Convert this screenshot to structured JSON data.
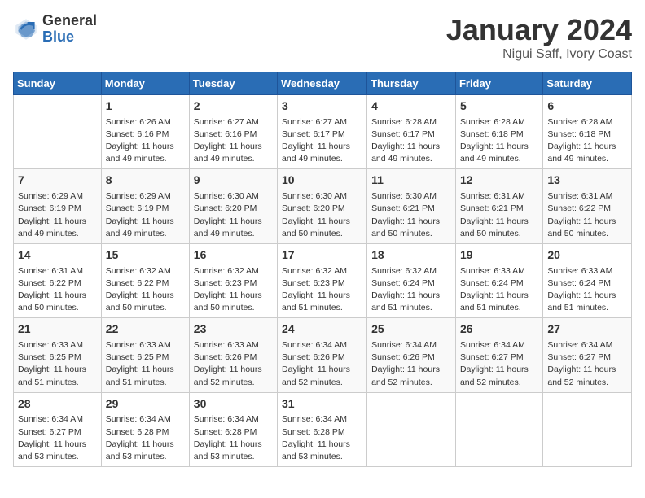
{
  "logo": {
    "general": "General",
    "blue": "Blue"
  },
  "title": "January 2024",
  "location": "Nigui Saff, Ivory Coast",
  "days_of_week": [
    "Sunday",
    "Monday",
    "Tuesday",
    "Wednesday",
    "Thursday",
    "Friday",
    "Saturday"
  ],
  "weeks": [
    [
      {
        "day": "",
        "info": ""
      },
      {
        "day": "1",
        "info": "Sunrise: 6:26 AM\nSunset: 6:16 PM\nDaylight: 11 hours\nand 49 minutes."
      },
      {
        "day": "2",
        "info": "Sunrise: 6:27 AM\nSunset: 6:16 PM\nDaylight: 11 hours\nand 49 minutes."
      },
      {
        "day": "3",
        "info": "Sunrise: 6:27 AM\nSunset: 6:17 PM\nDaylight: 11 hours\nand 49 minutes."
      },
      {
        "day": "4",
        "info": "Sunrise: 6:28 AM\nSunset: 6:17 PM\nDaylight: 11 hours\nand 49 minutes."
      },
      {
        "day": "5",
        "info": "Sunrise: 6:28 AM\nSunset: 6:18 PM\nDaylight: 11 hours\nand 49 minutes."
      },
      {
        "day": "6",
        "info": "Sunrise: 6:28 AM\nSunset: 6:18 PM\nDaylight: 11 hours\nand 49 minutes."
      }
    ],
    [
      {
        "day": "7",
        "info": "Sunrise: 6:29 AM\nSunset: 6:19 PM\nDaylight: 11 hours\nand 49 minutes."
      },
      {
        "day": "8",
        "info": "Sunrise: 6:29 AM\nSunset: 6:19 PM\nDaylight: 11 hours\nand 49 minutes."
      },
      {
        "day": "9",
        "info": "Sunrise: 6:30 AM\nSunset: 6:20 PM\nDaylight: 11 hours\nand 49 minutes."
      },
      {
        "day": "10",
        "info": "Sunrise: 6:30 AM\nSunset: 6:20 PM\nDaylight: 11 hours\nand 50 minutes."
      },
      {
        "day": "11",
        "info": "Sunrise: 6:30 AM\nSunset: 6:21 PM\nDaylight: 11 hours\nand 50 minutes."
      },
      {
        "day": "12",
        "info": "Sunrise: 6:31 AM\nSunset: 6:21 PM\nDaylight: 11 hours\nand 50 minutes."
      },
      {
        "day": "13",
        "info": "Sunrise: 6:31 AM\nSunset: 6:22 PM\nDaylight: 11 hours\nand 50 minutes."
      }
    ],
    [
      {
        "day": "14",
        "info": "Sunrise: 6:31 AM\nSunset: 6:22 PM\nDaylight: 11 hours\nand 50 minutes."
      },
      {
        "day": "15",
        "info": "Sunrise: 6:32 AM\nSunset: 6:22 PM\nDaylight: 11 hours\nand 50 minutes."
      },
      {
        "day": "16",
        "info": "Sunrise: 6:32 AM\nSunset: 6:23 PM\nDaylight: 11 hours\nand 50 minutes."
      },
      {
        "day": "17",
        "info": "Sunrise: 6:32 AM\nSunset: 6:23 PM\nDaylight: 11 hours\nand 51 minutes."
      },
      {
        "day": "18",
        "info": "Sunrise: 6:32 AM\nSunset: 6:24 PM\nDaylight: 11 hours\nand 51 minutes."
      },
      {
        "day": "19",
        "info": "Sunrise: 6:33 AM\nSunset: 6:24 PM\nDaylight: 11 hours\nand 51 minutes."
      },
      {
        "day": "20",
        "info": "Sunrise: 6:33 AM\nSunset: 6:24 PM\nDaylight: 11 hours\nand 51 minutes."
      }
    ],
    [
      {
        "day": "21",
        "info": "Sunrise: 6:33 AM\nSunset: 6:25 PM\nDaylight: 11 hours\nand 51 minutes."
      },
      {
        "day": "22",
        "info": "Sunrise: 6:33 AM\nSunset: 6:25 PM\nDaylight: 11 hours\nand 51 minutes."
      },
      {
        "day": "23",
        "info": "Sunrise: 6:33 AM\nSunset: 6:26 PM\nDaylight: 11 hours\nand 52 minutes."
      },
      {
        "day": "24",
        "info": "Sunrise: 6:34 AM\nSunset: 6:26 PM\nDaylight: 11 hours\nand 52 minutes."
      },
      {
        "day": "25",
        "info": "Sunrise: 6:34 AM\nSunset: 6:26 PM\nDaylight: 11 hours\nand 52 minutes."
      },
      {
        "day": "26",
        "info": "Sunrise: 6:34 AM\nSunset: 6:27 PM\nDaylight: 11 hours\nand 52 minutes."
      },
      {
        "day": "27",
        "info": "Sunrise: 6:34 AM\nSunset: 6:27 PM\nDaylight: 11 hours\nand 52 minutes."
      }
    ],
    [
      {
        "day": "28",
        "info": "Sunrise: 6:34 AM\nSunset: 6:27 PM\nDaylight: 11 hours\nand 53 minutes."
      },
      {
        "day": "29",
        "info": "Sunrise: 6:34 AM\nSunset: 6:28 PM\nDaylight: 11 hours\nand 53 minutes."
      },
      {
        "day": "30",
        "info": "Sunrise: 6:34 AM\nSunset: 6:28 PM\nDaylight: 11 hours\nand 53 minutes."
      },
      {
        "day": "31",
        "info": "Sunrise: 6:34 AM\nSunset: 6:28 PM\nDaylight: 11 hours\nand 53 minutes."
      },
      {
        "day": "",
        "info": ""
      },
      {
        "day": "",
        "info": ""
      },
      {
        "day": "",
        "info": ""
      }
    ]
  ]
}
